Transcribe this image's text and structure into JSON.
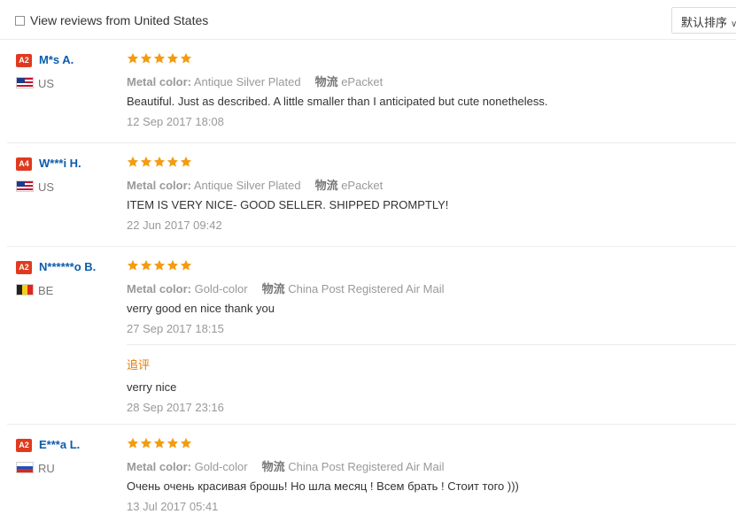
{
  "filter": {
    "label": "View reviews from United States",
    "checked": false
  },
  "sort": {
    "label": "默认排序"
  },
  "labels": {
    "metal_color": "Metal color:",
    "logistics": "物流",
    "followup": "追评"
  },
  "colors": {
    "badge": "#e03a1e",
    "name": "#0b5cad",
    "star": "#f39c12",
    "followup": "#e37b00"
  },
  "reviews": [
    {
      "level": "A2",
      "name": "M*s A.",
      "country": "US",
      "stars": 5,
      "metal_color": "Antique Silver Plated",
      "shipping": "ePacket",
      "text": "Beautiful. Just as described. A little smaller than I anticipated but cute nonetheless.",
      "date": "12 Sep 2017 18:08"
    },
    {
      "level": "A4",
      "name": "W***i H.",
      "country": "US",
      "stars": 5,
      "metal_color": "Antique Silver Plated",
      "shipping": "ePacket",
      "text": "ITEM IS VERY NICE- GOOD SELLER. SHIPPED PROMPTLY!",
      "date": "22 Jun 2017 09:42"
    },
    {
      "level": "A2",
      "name": "N******o B.",
      "country": "BE",
      "stars": 5,
      "metal_color": "Gold-color",
      "shipping": "China Post Registered Air Mail",
      "text": "verry good en nice thank you",
      "date": "27 Sep 2017 18:15",
      "followup_text": "verry nice",
      "followup_date": "28 Sep 2017 23:16"
    },
    {
      "level": "A2",
      "name": "E***a L.",
      "country": "RU",
      "stars": 5,
      "metal_color": "Gold-color",
      "shipping": "China Post Registered Air Mail",
      "text": "Очень очень красивая брошь! Но шла месяц ! Всем брать ! Стоит того )))",
      "date": "13 Jul 2017 05:41"
    }
  ]
}
